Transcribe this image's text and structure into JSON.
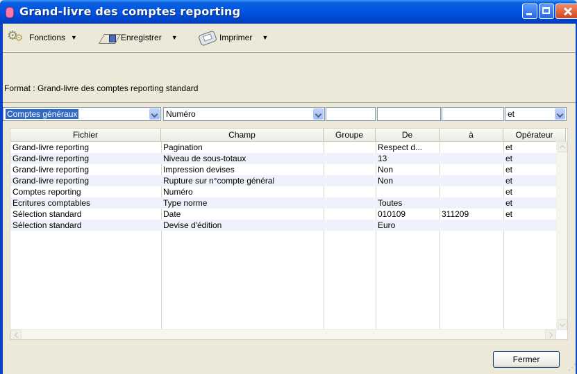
{
  "window": {
    "title": "Grand-livre des comptes reporting"
  },
  "toolbar": {
    "functions_label": "Fonctions",
    "save_label": "Enregistrer",
    "print_label": "Imprimer",
    "caret": "▼"
  },
  "format": {
    "text": "Format : Grand-livre des comptes reporting standard"
  },
  "filter": {
    "file_select": "Comptes généraux",
    "field_select": "Numéro",
    "group_value": "",
    "from_value": "",
    "to_value": "",
    "operator_select": "et"
  },
  "grid": {
    "columns": [
      "Fichier",
      "Champ",
      "Groupe",
      "De",
      "à",
      "Opérateur"
    ],
    "rows": [
      [
        "Grand-livre reporting",
        "Pagination",
        "",
        "Respect d...",
        "",
        "et"
      ],
      [
        "Grand-livre reporting",
        "Niveau de sous-totaux",
        "",
        "13",
        "",
        "et"
      ],
      [
        "Grand-livre reporting",
        "Impression devises",
        "",
        "Non",
        "",
        "et"
      ],
      [
        "Grand-livre reporting",
        "Rupture sur n°compte général",
        "",
        "Non",
        "",
        "et"
      ],
      [
        "Comptes reporting",
        "Numéro",
        "",
        "",
        "",
        "et"
      ],
      [
        "Ecritures comptables",
        "Type norme",
        "",
        "Toutes",
        "",
        "et"
      ],
      [
        "Sélection standard",
        "Date",
        "",
        "010109",
        "311209",
        "et"
      ],
      [
        "Sélection standard",
        "Devise d'édition",
        "",
        "Euro",
        "",
        ""
      ]
    ]
  },
  "footer": {
    "close_label": "Fermer"
  },
  "colors": {
    "titlebar": "#0055e5",
    "selection": "#316ac5",
    "alt_row": "#eef3fb"
  }
}
